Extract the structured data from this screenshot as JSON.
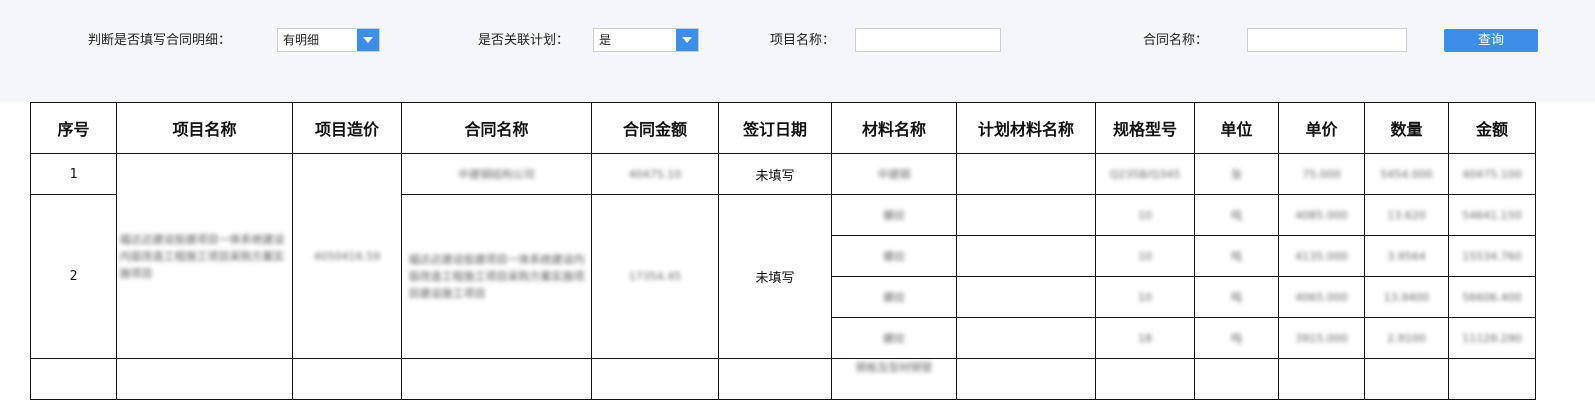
{
  "filters": {
    "detail_label": "判断是否填写合同明细：",
    "detail_value": "有明细",
    "linked_label": "是否关联计划：",
    "linked_value": "是",
    "project_label": "项目名称：",
    "project_value": "",
    "contract_label": "合同名称：",
    "contract_value": "",
    "query_label": "查询"
  },
  "table": {
    "headers": [
      "序号",
      "项目名称",
      "项目造价",
      "合同名称",
      "合同金额",
      "签订日期",
      "材料名称",
      "计划材料名称",
      "规格型号",
      "单位",
      "单价",
      "数量",
      "金额"
    ],
    "rows": [
      {
        "seq": "1",
        "project_name": "福达达建设投建项目一体系统建设内容改造工程施工项目采购方案实施项目",
        "project_cost": "4050416.59",
        "contract_name": "中建钢结构公司",
        "contract_amount": "40475.10",
        "sign_date": "未填写",
        "material": "中建钢",
        "plan_material": "",
        "spec": "Q235B/Q345",
        "unit": "张",
        "price": "75.000",
        "qty": "5454.000",
        "amount": "40475.100"
      },
      {
        "seq": "2",
        "contract_name": "福达达建设投建项目一体系统建设内容改造工程施工项目采购方案实施项目建设施工项目",
        "contract_amount": "17354.45",
        "sign_date": "未填写",
        "items": [
          {
            "material": "螺纹",
            "plan_material": "",
            "spec": "10",
            "unit": "吨",
            "price": "4085.000",
            "qty": "13.620",
            "amount": "54641.150"
          },
          {
            "material": "螺纹",
            "plan_material": "",
            "spec": "10",
            "unit": "吨",
            "price": "4135.000",
            "qty": "3.9564",
            "amount": "15534.760"
          },
          {
            "material": "螺纹",
            "plan_material": "",
            "spec": "10",
            "unit": "吨",
            "price": "4065.000",
            "qty": "13.9400",
            "amount": "56606.400"
          },
          {
            "material": "螺纹",
            "plan_material": "",
            "spec": "18",
            "unit": "吨",
            "price": "3915.000",
            "qty": "2.9100",
            "amount": "11128.290"
          }
        ]
      },
      {
        "material": "钢板及型材钢管"
      }
    ]
  },
  "colors": {
    "accent": "#3d8ee8",
    "filter_bg": "#f4f6f9",
    "grid_line": "#111111"
  }
}
